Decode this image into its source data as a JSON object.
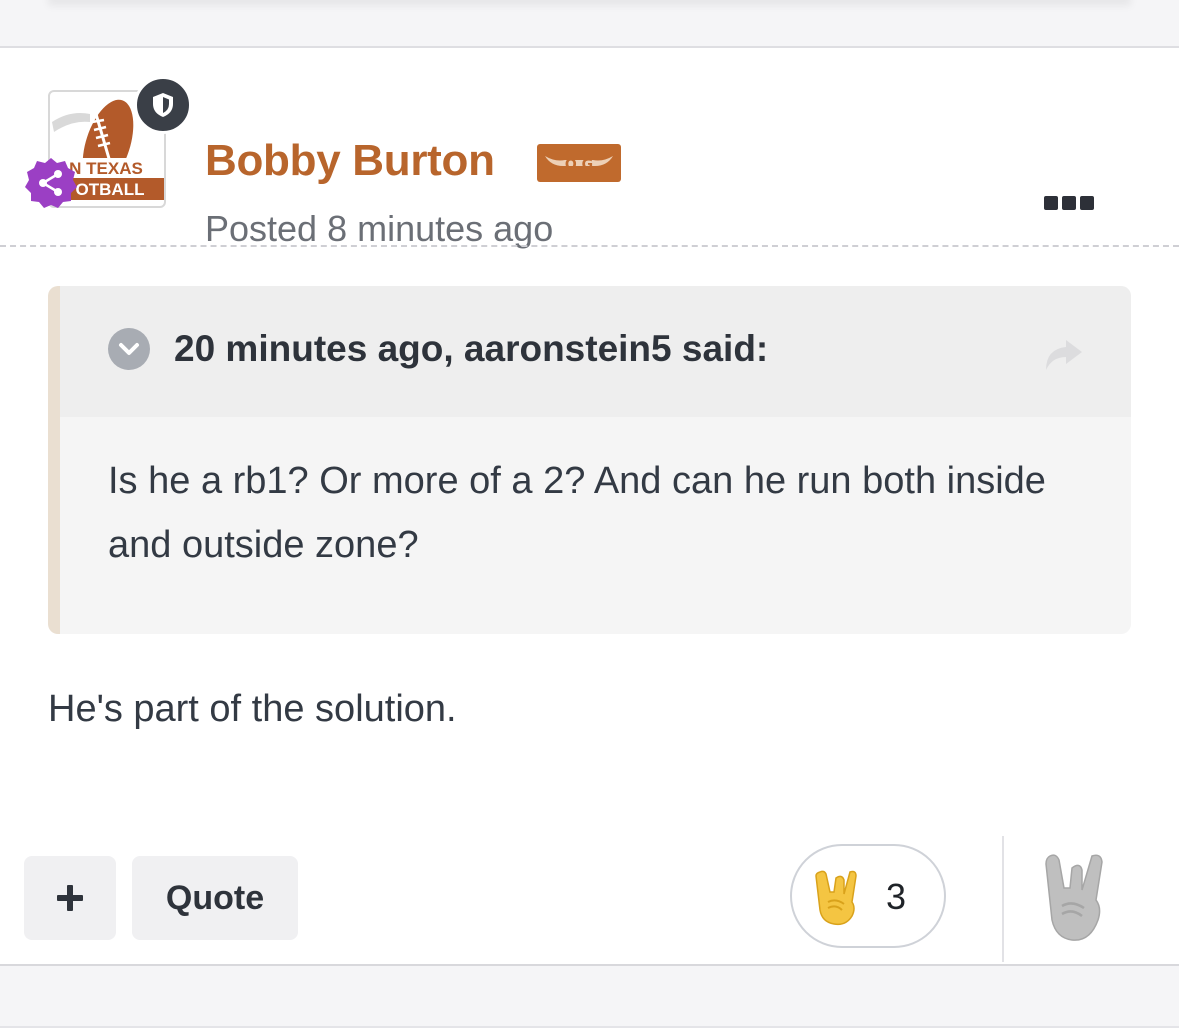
{
  "author": {
    "name": "Bobby Burton",
    "badge": "O G",
    "avatar_text_line1": "N TEXAS",
    "avatar_text_line2": "OTBALL"
  },
  "post": {
    "posted": "Posted 8 minutes ago",
    "body": "He's part of the solution."
  },
  "quote": {
    "citation": "20 minutes ago, aaronstein5 said:",
    "body": "Is he a rb1? Or more of a 2? And can he run both inside and outside zone?"
  },
  "actions": {
    "plus_label": "+",
    "quote_label": "Quote"
  },
  "reactions": {
    "count": "3",
    "emoji": "hook-em-hand-icon"
  },
  "colors": {
    "author": "#b8652c",
    "badge": "#c06a2d",
    "mod_badge": "#3a3f47",
    "share_badge": "#9b3fc4"
  }
}
